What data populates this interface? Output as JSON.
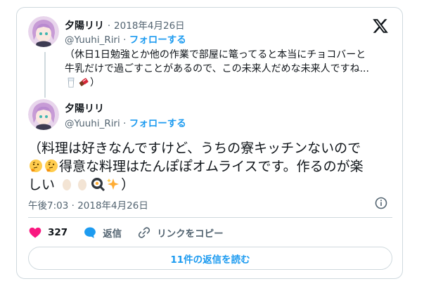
{
  "quoted_tweet": {
    "name": "夕陽リリ",
    "date_sep": "·",
    "date": "2018年4月26日",
    "handle": "@Yuuhi_Riri",
    "follow_sep": "·",
    "follow_label": "フォローする",
    "text_line1": "（休日1日勉強とか他の作業で部屋に篭ってると本当にチョコバーと",
    "text_line2": "牛乳だけで過ごすことがあるので、この未来人だめな未来人ですね...",
    "text_tail": "）",
    "emojis": [
      "glass-of-milk-emoji",
      "chocolate-bar-emoji"
    ]
  },
  "main_tweet": {
    "name": "夕陽リリ",
    "handle": "@Yuuhi_Riri",
    "follow_sep": "·",
    "follow_label": "フォローする",
    "text_line1": "（料理は好きなんですけど、うちの寮キッチンないので",
    "text_line2": "得意な料理はたんぽぽオムライスです。作るのが楽",
    "text_line3_start": "しい",
    "text_tail": "）",
    "emojis_line2": [
      "thinking-face-emoji",
      "thinking-face-emoji"
    ],
    "emojis_line3": [
      "egg-emoji",
      "egg-emoji",
      "cooking-egg-emoji",
      "sparkles-emoji"
    ],
    "timestamp": "午後7:03 · 2018年4月26日"
  },
  "actions": {
    "like_count": "327",
    "reply_label": "返信",
    "copy_link_label": "リンクをコピー"
  },
  "replies_button": "11件の返信を読む",
  "colors": {
    "accent": "#1d9bf0",
    "like": "#f91880",
    "secondary_text": "#536471",
    "border": "#cfd9de"
  },
  "icons": [
    "x-logo-icon",
    "info-icon",
    "heart-icon",
    "reply-bubble-icon",
    "link-icon"
  ]
}
